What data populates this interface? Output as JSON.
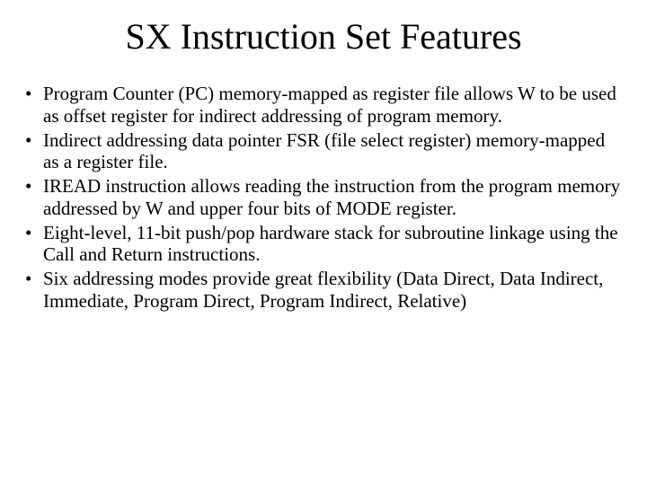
{
  "title": "SX Instruction Set Features",
  "bullets": [
    "Program Counter (PC) memory-mapped as register file allows W to be used as offset register for indirect addressing of program memory.",
    "Indirect addressing data pointer FSR (file select register) memory-mapped as a register file.",
    "IREAD instruction allows reading the instruction from the program memory addressed by W and upper four bits of MODE register.",
    "Eight-level, 11-bit push/pop hardware stack for subroutine linkage using the Call and Return instructions.",
    "Six addressing modes provide great flexibility (Data Direct, Data Indirect, Immediate, Program Direct, Program Indirect, Relative)"
  ]
}
